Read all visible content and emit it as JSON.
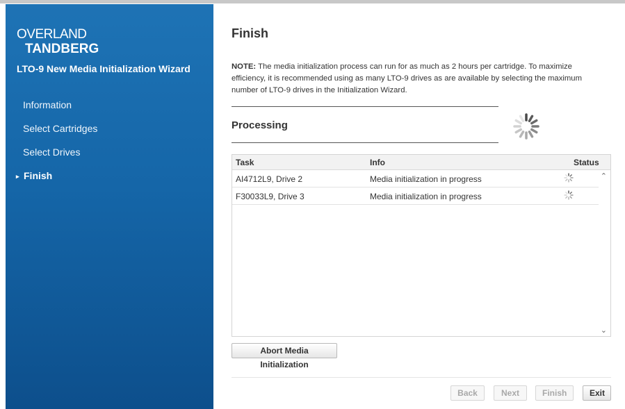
{
  "sidebar": {
    "logo_line1": "OVERLAND",
    "logo_line2": "TANDBERG",
    "wizard_title": "LTO-9 New Media Initialization Wizard",
    "items": [
      {
        "label": "Information"
      },
      {
        "label": "Select Cartridges"
      },
      {
        "label": "Select Drives"
      },
      {
        "label": "Finish"
      }
    ],
    "active_arrow": "▸"
  },
  "main": {
    "title": "Finish",
    "note_label": "NOTE:",
    "note_text": " The media initialization process can run for as much as 2 hours per cartridge. To maximize efficiency, it is recommended using as many LTO-9 drives as are available by selecting the maximum number of LTO-9 drives in the Initialization Wizard.",
    "processing_label": "Processing",
    "spinner_icon": "loading-spinner-icon"
  },
  "table": {
    "headers": {
      "task": "Task",
      "info": "Info",
      "status": "Status"
    },
    "rows": [
      {
        "task": "AI4712L9, Drive 2",
        "info": "Media initialization in progress"
      },
      {
        "task": "F30033L9, Drive 3",
        "info": "Media initialization in progress"
      }
    ]
  },
  "buttons": {
    "abort": "Abort Media Initialization",
    "back": "Back",
    "next": "Next",
    "finish": "Finish",
    "exit": "Exit"
  },
  "colors": {
    "sidebar_top": "#1e73b5",
    "sidebar_bottom": "#0d4f8c",
    "text": "#333333"
  }
}
